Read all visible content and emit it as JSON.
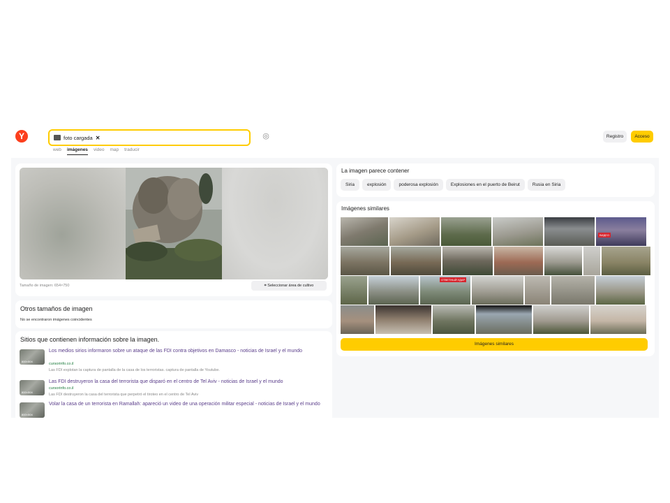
{
  "header": {
    "logo": "Y",
    "search_chip": "foto cargada",
    "tabs": [
      "web",
      "imágenes",
      "video",
      "map",
      "traducir"
    ],
    "active_tab": "imágenes",
    "register_label": "Registro",
    "login_label": "Acceso",
    "accent_color": "#ffcc00"
  },
  "preview": {
    "size_text": "Tamaño de imagen: 654×750",
    "crop_label": "Seleccionar área de cultivo"
  },
  "other_sizes": {
    "title": "Otros tamaños de imagen",
    "subtitle": "No se encontraron imágenes coincidentes"
  },
  "sites": {
    "title": "Sitios que contienen información sobre la imagen.",
    "items": [
      {
        "thumb_label": "800×504",
        "title": "Los medios sirios informaron sobre un ataque de las FDI contra objetivos en Damasco - noticias de Israel y el mundo",
        "domain": "cursorinfo.co.il",
        "desc": "Las FDI explotan la captura de pantalla de la casa de los terroristas. captura de pantalla de Youtube."
      },
      {
        "thumb_label": "800×504",
        "title": "Las FDI destruyeron la casa del terrorista que disparó en el centro de Tel Aviv - noticias de Israel y el mundo",
        "domain": "cursorinfo.co.il",
        "desc": "Las FDI destruyeron la casa del terrorista que perpetró el tiroteo en el centro de Tel Aviv"
      },
      {
        "thumb_label": "800×504",
        "title": "Volar la casa de un terrorista en Ramallah: apareció un video de una operación militar especial - noticias de Israel y el mundo",
        "domain": "",
        "desc": ""
      }
    ]
  },
  "tags": {
    "title": "La imagen parece contener",
    "items": [
      "Siria",
      "explosión",
      "poderosa explosión",
      "Explosiones en el puerto de Beirut",
      "Rusia en Siria"
    ]
  },
  "similar": {
    "title": "Imágenes similares",
    "button_label": "Imágenes similares",
    "overlay_badges": [
      "ОТВЕТНЫЙ УДАР",
      "ВИДЕО"
    ]
  }
}
